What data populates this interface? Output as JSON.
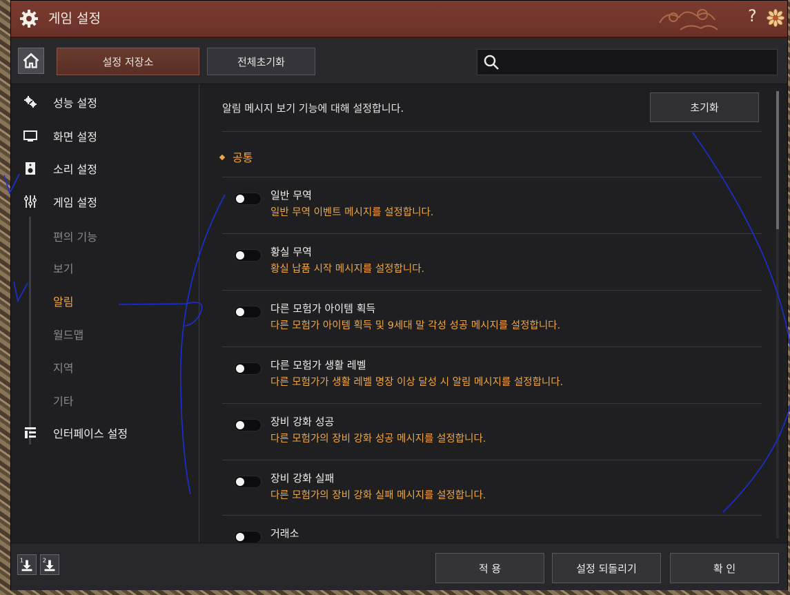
{
  "window": {
    "title": "게임 설정",
    "help": "?"
  },
  "toolbar": {
    "save_store": "설정 저장소",
    "reset_all": "전체초기화",
    "search_placeholder": ""
  },
  "sidebar": {
    "items": [
      {
        "label": "성능 설정",
        "icon": "gears-icon"
      },
      {
        "label": "화면 설정",
        "icon": "monitor-icon"
      },
      {
        "label": "소리 설정",
        "icon": "speaker-icon"
      },
      {
        "label": "게임 설정",
        "icon": "sliders-icon"
      },
      {
        "label": "인터페이스 설정",
        "icon": "layout-icon"
      }
    ],
    "subitems": [
      "편의 기능",
      "보기",
      "알림",
      "월드맵",
      "지역",
      "기타"
    ],
    "active_sub": "알림"
  },
  "main": {
    "description": "알림 메시지 보기 기능에 대해 설정합니다.",
    "reset_label": "초기화",
    "section": "공통",
    "options": [
      {
        "title": "일반 무역",
        "desc": "일반 무역 이벤트 메시지를 설정합니다."
      },
      {
        "title": "황실 무역",
        "desc": "황실 납품 시작 메시지를 설정합니다."
      },
      {
        "title": "다른 모험가 아이템 획득",
        "desc": "다른 모험가 아이템 획득 및 9세대 말 각성 성공 메시지를 설정합니다."
      },
      {
        "title": "다른 모험가 생활 레벨",
        "desc": "다른 모험가가 생활 레벨 명장 이상 달성 시 알림 메시지를 설정합니다."
      },
      {
        "title": "장비 강화 성공",
        "desc": "다른 모험가의 장비 강화 성공 메시지를 설정합니다."
      },
      {
        "title": "장비 강화 실패",
        "desc": "다른 모험가의 장비 강화 실패 메시지를 설정합니다."
      },
      {
        "title": "거래소",
        "desc": ""
      }
    ]
  },
  "footer": {
    "apply": "적 용",
    "revert": "설정 되돌리기",
    "confirm": "확 인",
    "slot1": "1",
    "slot2": "2"
  },
  "colors": {
    "accent": "#f0a640",
    "titlebar": "#6e3229",
    "panel": "#1f1f22"
  }
}
